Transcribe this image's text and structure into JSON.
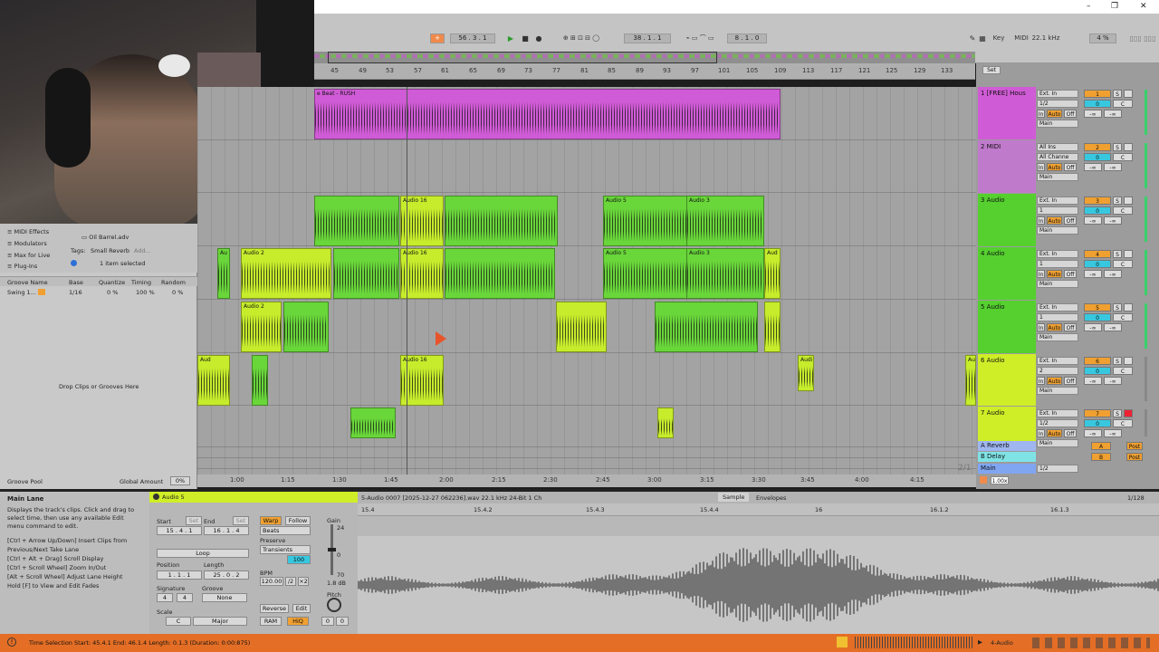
{
  "window": {
    "minimize": "–",
    "maximize": "❐",
    "close": "✕"
  },
  "transport": {
    "tempo_box": "+",
    "position": "56 .  3 .  1",
    "loop_start": "38 .  1 .  1",
    "loop_length": "8 .  1 .  0",
    "key": "Key",
    "midi": "MIDI",
    "sample_rate": "22.1 kHz",
    "cpu": "4 %"
  },
  "ruler": {
    "ticks": [
      "45",
      "49",
      "53",
      "57",
      "61",
      "65",
      "69",
      "73",
      "77",
      "81",
      "85",
      "89",
      "93",
      "97",
      "101",
      "105",
      "109",
      "113",
      "117",
      "121",
      "125",
      "129",
      "133"
    ]
  },
  "browser": {
    "categories": [
      "MIDI Effects",
      "Modulators",
      "Max for Live",
      "Plug-Ins"
    ],
    "file": "Oil Barrel.adv",
    "tags_label": "Tags:",
    "tag": "Small Reverb",
    "tag_add": "Add...",
    "status": "1 item selected",
    "groove_headers": [
      "Groove Name",
      "Base",
      "Quantize",
      "Timing",
      "Random"
    ],
    "groove_row": {
      "name": "Swing 1...",
      "base": "1/16",
      "quantize": "0 %",
      "timing": "100 %",
      "random": "0 %"
    },
    "drop_hint": "Drop Clips or Grooves Here",
    "groove_pool": "Groove Pool",
    "global_amount_label": "Global Amount",
    "global_amount": "0%"
  },
  "tracks": [
    {
      "name": "1 [FREE] Hous",
      "color": "#d05bd6",
      "num": "1",
      "input": "Ext. In",
      "chan": "1/2",
      "out": "Main"
    },
    {
      "name": "2 MIDI",
      "color": "#c07acc",
      "num": "2",
      "input": "All Ins",
      "chan": "All Channe",
      "out": "Main"
    },
    {
      "name": "3 Audio",
      "color": "#55d02e",
      "num": "3",
      "input": "Ext. In",
      "chan": "1",
      "out": "Main"
    },
    {
      "name": "4 Audio",
      "color": "#55d02e",
      "num": "4",
      "input": "Ext. In",
      "chan": "1",
      "out": "Main"
    },
    {
      "name": "5 Audio",
      "color": "#55d02e",
      "num": "5",
      "input": "Ext. In",
      "chan": "1",
      "out": "Main"
    },
    {
      "name": "6 Audio",
      "color": "#cfee27",
      "num": "6",
      "input": "Ext. In",
      "chan": "2",
      "out": "Main"
    },
    {
      "name": "7 Audio",
      "color": "#cfee27",
      "num": "7",
      "input": "Ext. In",
      "chan": "1/2",
      "out": "Main"
    }
  ],
  "returns": [
    {
      "name": "A Reverb",
      "color": "#9fb6f0",
      "letter": "A",
      "post": "Post"
    },
    {
      "name": "B Delay",
      "color": "#7fe3e6",
      "letter": "B",
      "post": "Post"
    },
    {
      "name": "Main",
      "color": "#80a6f2",
      "chan": "1/2"
    }
  ],
  "clips": {
    "beat": "e Beat - RUSH",
    "audio16": "Audio 16",
    "audio2": "Audio 2",
    "audio3": "Audio 3",
    "audio5": "Audio 5",
    "au": "Au",
    "aud": "Aud",
    "audi": "Audi"
  },
  "mixer_labels": {
    "in": "In",
    "auto": "Auto",
    "off": "Off",
    "s": "S",
    "c": "C",
    "zero": "0",
    "neg_inf": "-∞"
  },
  "time_ruler": {
    "ticks": [
      "1:00",
      "1:15",
      "1:30",
      "1:45",
      "2:00",
      "2:15",
      "2:30",
      "2:45",
      "3:00",
      "3:15",
      "3:30",
      "3:45",
      "4:00",
      "4:15"
    ],
    "page": "2/1"
  },
  "zoom": "1.00x",
  "set": "Set",
  "info": {
    "title": "Main Lane",
    "lines": [
      "Displays the track's clips. Click and drag to select time, then use any available Edit menu command to edit.",
      "[Ctrl + Arrow Up/Down] Insert Clips from Previous/Next Take Lane",
      "[Ctrl + Alt + Drag] Scroll Display",
      "[Ctrl + Scroll Wheel] Zoom In/Out",
      "[Alt + Scroll Wheel] Adjust Lane Height",
      "Hold [F] to View and Edit Fades"
    ]
  },
  "clip_props": {
    "clip_name": "Audio 5",
    "start_label": "Start",
    "end_label": "End",
    "set": "Set",
    "start": "15 .  4 .  1",
    "end": "16 .  1 .  4",
    "loop": "Loop",
    "position_label": "Position",
    "length_label": "Length",
    "position": "1 .  1 .  1",
    "length": "25 .  0 .  2",
    "signature_label": "Signature",
    "groove_label": "Groove",
    "sig_num": "4",
    "sig_den": "4",
    "groove": "None",
    "scale_label": "Scale",
    "scale_root": "C",
    "scale_mode": "Major",
    "warp": "Warp",
    "follow": "Follow",
    "beats": "Beats",
    "preserve_label": "Preserve",
    "preserve": "Transients",
    "preserve_val": "100",
    "bpm_label": "BPM",
    "bpm": "120.00",
    "half": "/2",
    "double": "×2",
    "reverse": "Reverse",
    "edit": "Edit",
    "ram": "RAM",
    "hiq": "HiQ",
    "gain_label": "Gain",
    "gain_top": "24",
    "gain_mid": "0",
    "gain_bot": "70",
    "gain_val": "1.8 dB",
    "pitch_label": "Pitch",
    "pitch": "0",
    "detune": "0"
  },
  "sample_editor": {
    "file": "5-Audio 0007 [2025-12-27 062236].wav",
    "rate": "22.1 kHz",
    "bits": "24-Bit",
    "channels": "1 Ch",
    "tabs": [
      "Sample",
      "Envelopes"
    ],
    "quant": "1/128",
    "ruler": [
      "15.4",
      "15.4.2",
      "15.4.3",
      "15.4.4",
      "16",
      "16.1.2",
      "16.1.3"
    ]
  },
  "status": {
    "text": "Time Selection   Start: 45.4.1   End: 46.1.4   Length: 0.1.3  (Duration: 0:00:875)",
    "track": "4-Audio"
  }
}
